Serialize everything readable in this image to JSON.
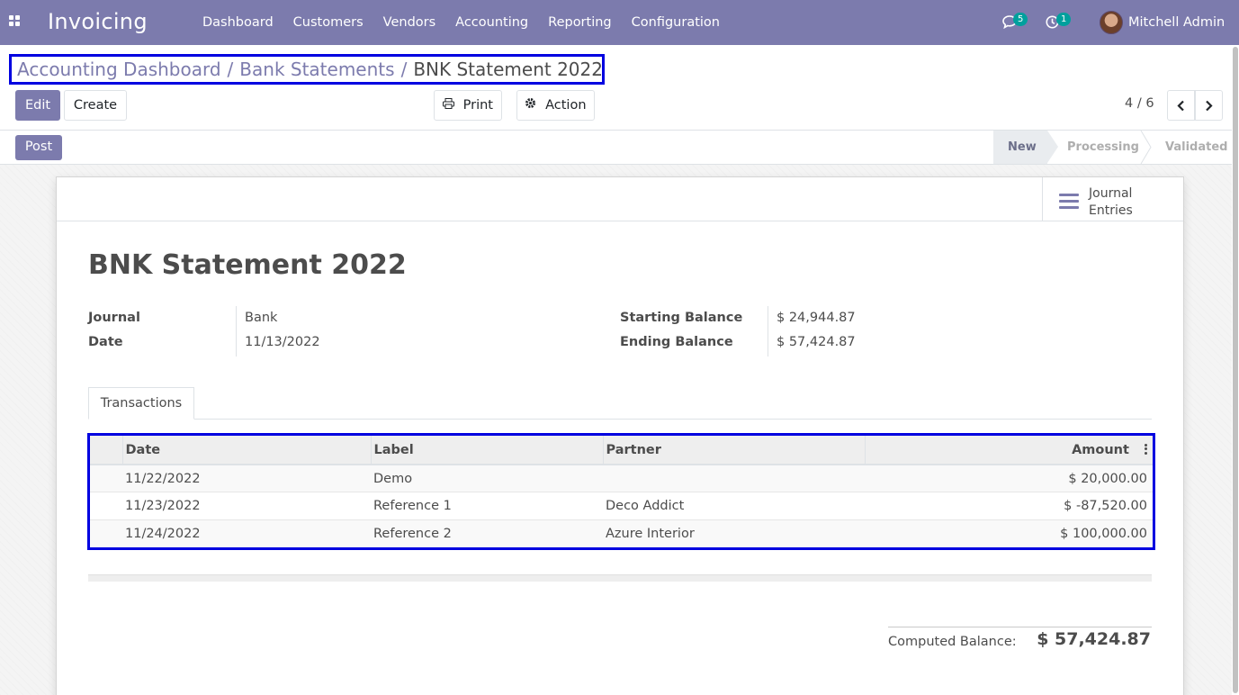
{
  "app": {
    "name": "Invoicing"
  },
  "nav": {
    "menu": [
      "Dashboard",
      "Customers",
      "Vendors",
      "Accounting",
      "Reporting",
      "Configuration"
    ]
  },
  "systray": {
    "messages": {
      "icon": "chat-icon",
      "count": "5"
    },
    "activities": {
      "icon": "clock-icon",
      "count": "1"
    },
    "user": {
      "name": "Mitchell Admin",
      "icon": "avatar"
    }
  },
  "breadcrumb": {
    "items": [
      "Accounting Dashboard",
      "Bank Statements"
    ],
    "separator": "/",
    "current": "BNK Statement 2022"
  },
  "toolbar": {
    "edit_label": "Edit",
    "create_label": "Create",
    "print_label": "Print",
    "action_label": "Action"
  },
  "pager": {
    "value": "4 / 6"
  },
  "statusbar": {
    "post_label": "Post",
    "stages": [
      "New",
      "Processing",
      "Validated"
    ],
    "active_stage": "New"
  },
  "smart_button": {
    "icon": "list-icon",
    "line1": "Journal",
    "line2": "Entries"
  },
  "record": {
    "title": "BNK Statement 2022",
    "fields": {
      "journal_label": "Journal",
      "journal_value": "Bank",
      "date_label": "Date",
      "date_value": "11/13/2022",
      "start_label": "Starting Balance",
      "start_value": "$ 24,944.87",
      "end_label": "Ending Balance",
      "end_value": "$ 57,424.87"
    }
  },
  "tabs": [
    "Transactions"
  ],
  "lines": {
    "columns": [
      "Date",
      "Label",
      "Partner",
      "Amount"
    ],
    "rows": [
      {
        "date": "11/22/2022",
        "label": "Demo",
        "partner": "",
        "amount": "$ 20,000.00"
      },
      {
        "date": "11/23/2022",
        "label": "Reference 1",
        "partner": "Deco Addict",
        "amount": "$ -87,520.00"
      },
      {
        "date": "11/24/2022",
        "label": "Reference 2",
        "partner": "Azure Interior",
        "amount": "$ 100,000.00"
      }
    ]
  },
  "totals": {
    "label": "Computed Balance:",
    "value": "$ 57,424.87"
  },
  "colors": {
    "brand": "#7c7bad",
    "highlight": "#0000e0",
    "badge": "#00a09d"
  }
}
